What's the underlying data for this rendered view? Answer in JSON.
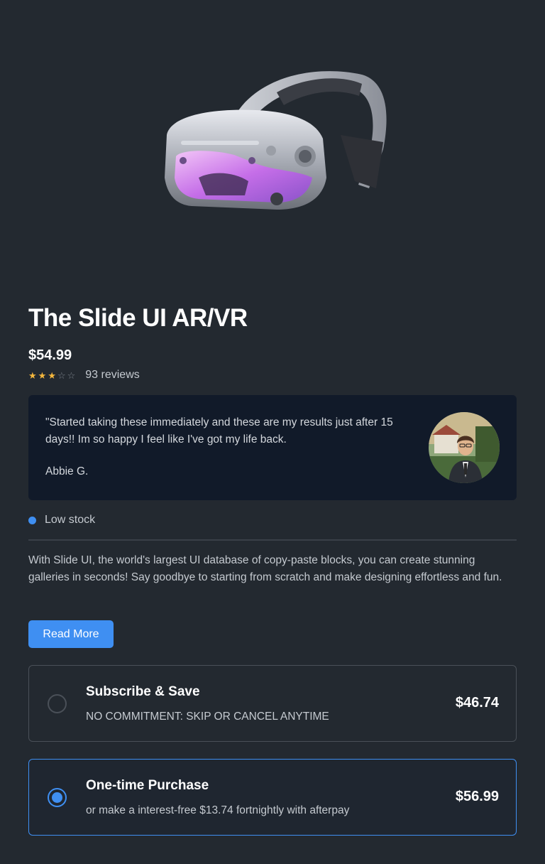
{
  "product": {
    "title": "The Slide UI AR/VR",
    "price": "$54.99",
    "rating": 3,
    "rating_max": 5,
    "reviews": "93 reviews"
  },
  "testimonial": {
    "quote": "\"Started taking these immediately and these are my results just after 15 days!! Im so happy I feel like I've got my life back.",
    "author": "Abbie G."
  },
  "stock": {
    "label": "Low stock",
    "color": "#3f8ff2"
  },
  "description": "With Slide UI, the world's largest UI database of copy-paste blocks, you can create stunning galleries in seconds! Say goodbye to starting from scratch and make designing effortless and fun.",
  "read_more_label": "Read More",
  "options": [
    {
      "title": "Subscribe & Save",
      "subtitle": "NO COMMITMENT: SKIP OR CANCEL ANYTIME",
      "price": "$46.74",
      "selected": false
    },
    {
      "title": "One-time Purchase",
      "subtitle": "or make a interest-free $13.74 fortnightly with afterpay",
      "price": "$56.99",
      "selected": true
    }
  ],
  "colors": {
    "background": "#232930",
    "accent": "#3f8ff2",
    "star": "#f4b73d",
    "card": "#111a29"
  }
}
